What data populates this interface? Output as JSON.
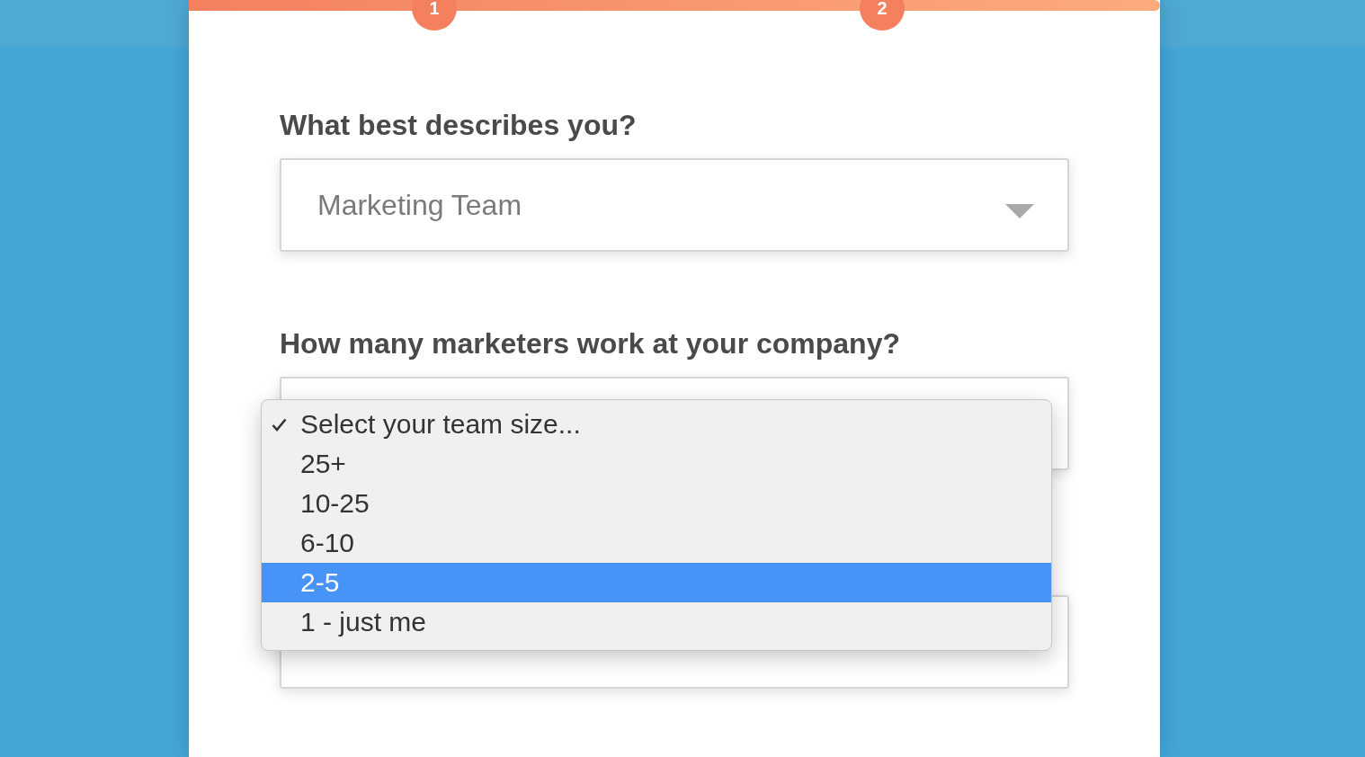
{
  "steps": [
    {
      "number": "1"
    },
    {
      "number": "2"
    }
  ],
  "questions": [
    {
      "kind": "select",
      "label": "What best describes you?",
      "value": "Marketing Team"
    },
    {
      "kind": "select",
      "label": "How many marketers work at your company?",
      "dropdown": {
        "options": [
          {
            "label": "Select your team size...",
            "checked": true,
            "highlighted": false
          },
          {
            "label": "25+",
            "checked": false,
            "highlighted": false
          },
          {
            "label": "10-25",
            "checked": false,
            "highlighted": false
          },
          {
            "label": "6-10",
            "checked": false,
            "highlighted": false
          },
          {
            "label": "2-5",
            "checked": false,
            "highlighted": true
          },
          {
            "label": "1 - just me",
            "checked": false,
            "highlighted": false
          }
        ]
      }
    },
    {
      "kind": "covered"
    }
  ]
}
